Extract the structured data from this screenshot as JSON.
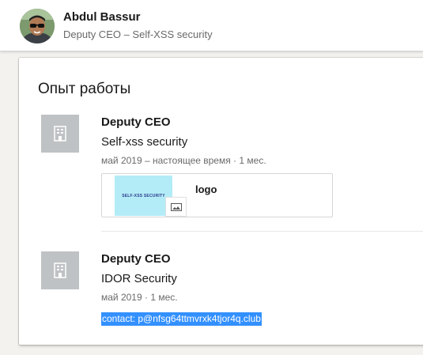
{
  "profile": {
    "name": "Abdul Bassur",
    "headline": "Deputy CEO – Self-XSS security"
  },
  "experience": {
    "section_title": "Опыт работы",
    "entries": [
      {
        "title": "Deputy CEO",
        "company": "Self-xss security",
        "dates": "май 2019 – настоящее время · 1 мес.",
        "logo_icon": "building-icon",
        "media": {
          "thumb_text": "SELF-XSS SECURITY",
          "title": "logo",
          "badge_icon": "image-icon"
        }
      },
      {
        "title": "Deputy CEO",
        "company": "IDOR Security",
        "dates": "май 2019 · 1 мес.",
        "logo_icon": "building-icon",
        "description": "contact: p@nfsg64ttmvrxk4tjor4q.club"
      }
    ]
  },
  "colors": {
    "selection": "#3390ff",
    "logo_placeholder": "#bfc2c4",
    "thumb_bg": "#b3ecf7"
  }
}
